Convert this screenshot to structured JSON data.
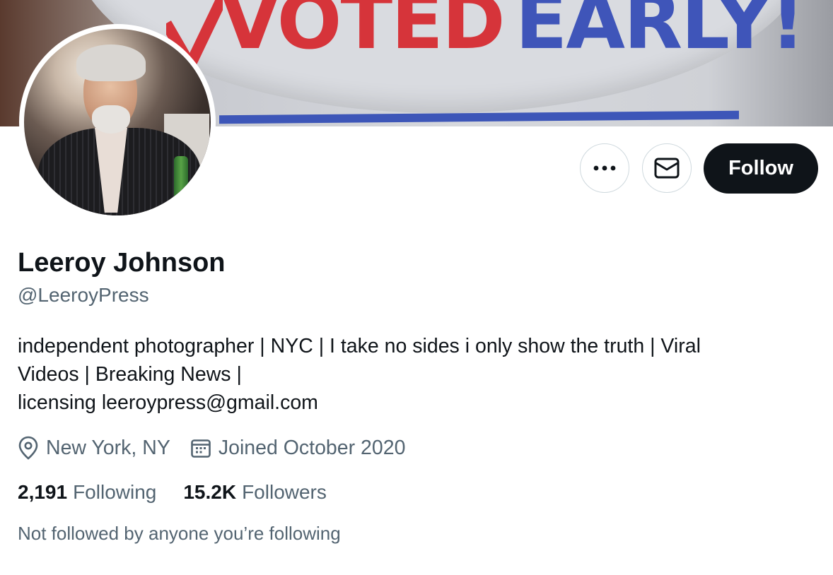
{
  "banner": {
    "text_red": "VOTED",
    "text_blue": "EARLY!",
    "colors": {
      "red": "#d6343a",
      "blue": "#3f55b9"
    }
  },
  "profile": {
    "display_name": "Leeroy Johnson",
    "handle": "@LeeroyPress",
    "bio_lines": [
      "independent photographer | NYC |  I take no sides i only show the truth | Viral",
      "Videos | Breaking News |",
      "licensing leeroypress@gmail.com"
    ],
    "location": "New York, NY",
    "joined": "Joined October 2020",
    "following_count": "2,191",
    "following_label": "Following",
    "followers_count": "15.2K",
    "followers_label": "Followers",
    "followed_by_note": "Not followed by anyone you’re following"
  },
  "actions": {
    "more_icon": "more-horizontal-icon",
    "message_icon": "envelope-icon",
    "follow_label": "Follow"
  },
  "colors": {
    "primary_text": "#0f1419",
    "secondary_text": "#536471",
    "button_border": "#cfd9de",
    "follow_bg": "#0f1419"
  }
}
